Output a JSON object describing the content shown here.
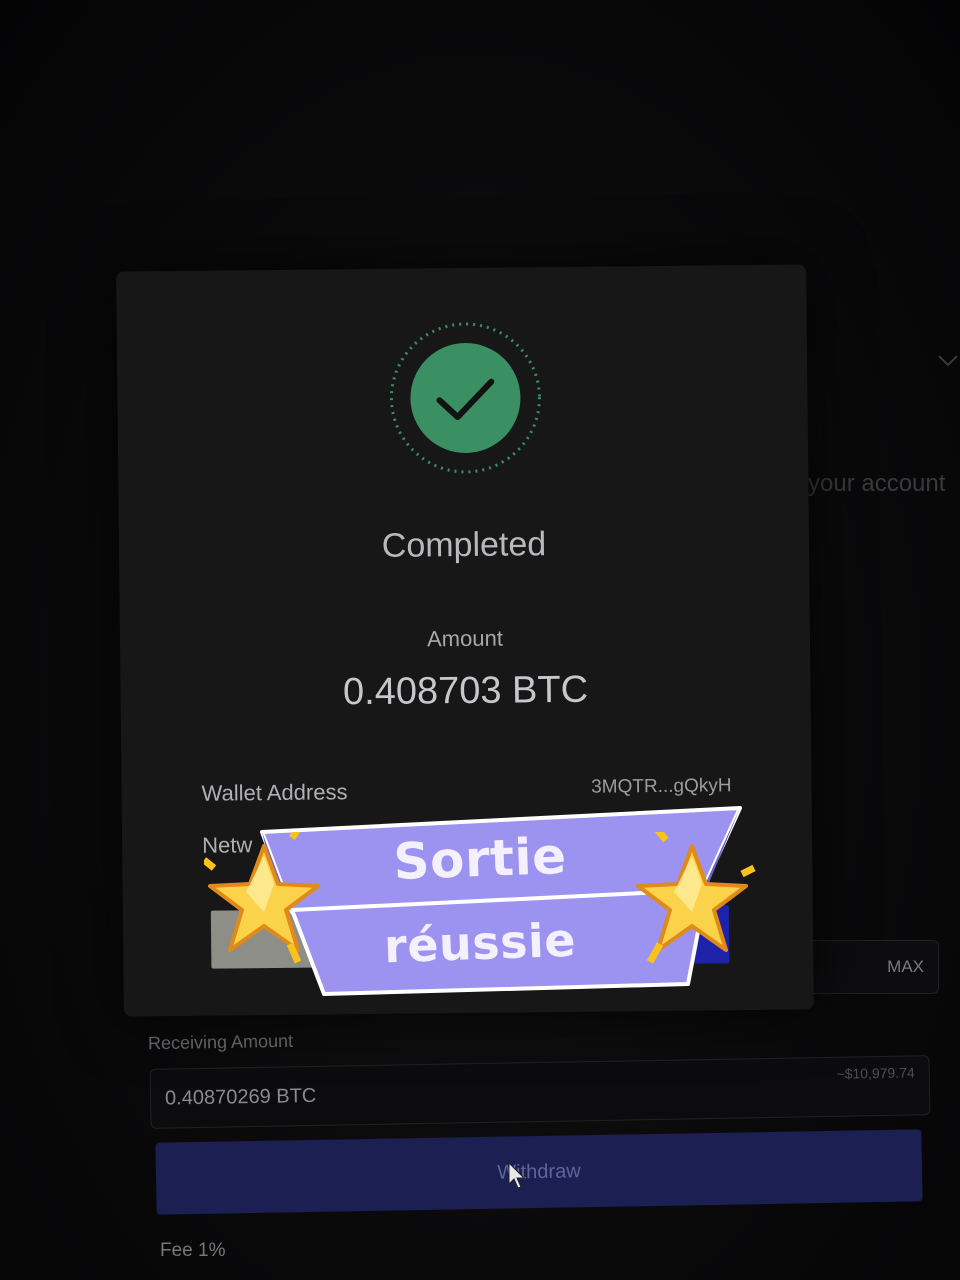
{
  "modal": {
    "status_title": "Completed",
    "amount_label": "Amount",
    "amount_value": "0.408703 BTC",
    "wallet_label": "Wallet Address",
    "wallet_value": "3MQTR...gQkyH",
    "network_label": "Netw",
    "status_icon": "checkmark-icon",
    "accent_color": "#3a8f63"
  },
  "background": {
    "account_text": "your account",
    "max_label": "MAX",
    "receiving_label": "Receiving Amount",
    "receiving_value": "0.40870269 BTC",
    "receiving_usd": "~$10,979.74",
    "withdraw_label": "Withdraw",
    "fee_label": "Fee 1%",
    "withdraw_color": "#1c1f52"
  },
  "sticker": {
    "line1": "Sortie",
    "line2": "réussie",
    "icon": "glowing-star-icon",
    "color": "#9c92f0"
  }
}
